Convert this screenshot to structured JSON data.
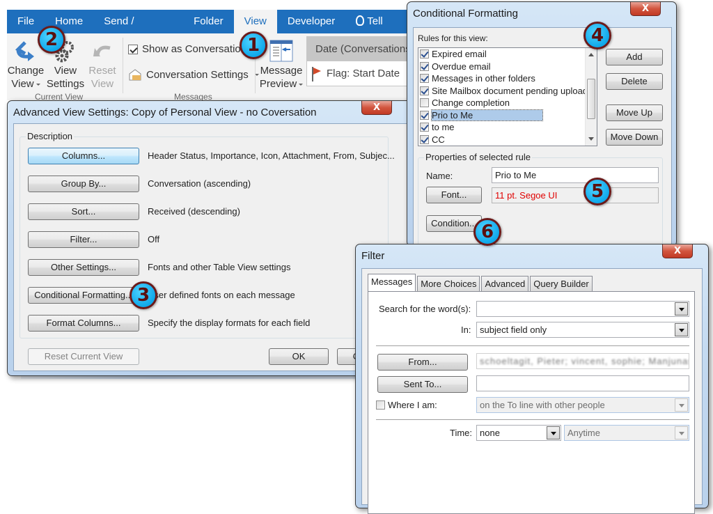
{
  "ribbon": {
    "tabs": [
      "File",
      "Home",
      "Send / Receive",
      "Folder",
      "View",
      "Developer",
      "Tell me"
    ],
    "active_tab": "View",
    "current_view": {
      "change_view": [
        "Change",
        "View"
      ],
      "view_settings": [
        "View",
        "Settings"
      ],
      "reset_view": [
        "Reset",
        "View"
      ],
      "group_label": "Current View"
    },
    "messages": {
      "show_as_conversations": "Show as Conversations",
      "show_as_conversations_checked": true,
      "conversation_settings": "Conversation Settings",
      "group_label": "Messages"
    },
    "message_preview": [
      "Message",
      "Preview"
    ],
    "arrangement": [
      "Date (Conversations)",
      "Flag: Start Date"
    ]
  },
  "advanced_view": {
    "title": "Advanced View Settings: Copy of Personal View - no Coversation",
    "close_label": "X",
    "section_label": "Description",
    "rows": [
      {
        "button": "Columns...",
        "value": "Header Status, Importance, Icon, Attachment, From, Subjec..."
      },
      {
        "button": "Group By...",
        "value": "Conversation (ascending)"
      },
      {
        "button": "Sort...",
        "value": "Received (descending)"
      },
      {
        "button": "Filter...",
        "value": "Off"
      },
      {
        "button": "Other Settings...",
        "value": "Fonts and other Table View settings"
      },
      {
        "button": "Conditional Formatting...",
        "value": "User defined fonts on each message"
      },
      {
        "button": "Format Columns...",
        "value": "Specify the display formats for each field"
      }
    ],
    "reset_button": "Reset Current View",
    "ok_button": "OK",
    "cancel_button": "Cancel"
  },
  "conditional_formatting": {
    "title": "Conditional Formatting",
    "close_label": "X",
    "rules_label": "Rules for this view:",
    "rules": [
      {
        "label": "Expired email",
        "checked": true
      },
      {
        "label": "Overdue email",
        "checked": true
      },
      {
        "label": "Messages in other folders",
        "checked": true
      },
      {
        "label": "Site Mailbox document pending upload",
        "checked": true
      },
      {
        "label": "Change completion",
        "checked": false
      },
      {
        "label": "Prio to Me",
        "checked": true,
        "selected": true
      },
      {
        "label": "to me",
        "checked": true
      },
      {
        "label": "CC",
        "checked": true
      }
    ],
    "buttons": {
      "add": "Add",
      "delete": "Delete",
      "move_up": "Move Up",
      "move_down": "Move Down"
    },
    "properties_label": "Properties of selected rule",
    "name_label": "Name:",
    "name_value": "Prio to Me",
    "font_button": "Font...",
    "font_preview": "11 pt. Segoe UI",
    "font_preview_color": "#e00000",
    "condition_button": "Condition..."
  },
  "filter": {
    "title": "Filter",
    "close_label": "X",
    "tabs": [
      "Messages",
      "More Choices",
      "Advanced",
      "Query Builder"
    ],
    "active_tab": "Messages",
    "search_label": "Search for the word(s):",
    "search_value": "",
    "in_label": "In:",
    "in_value": "subject field only",
    "from_button": "From...",
    "from_value": "schoeltagit, Pieter; vincent, sophie; Manjunas, adele",
    "sent_to_button": "Sent To...",
    "sent_to_value": "",
    "where_i_am_label": "Where I am:",
    "where_i_am_checked": false,
    "where_i_am_value": "on the To line with other people",
    "time_label": "Time:",
    "time_value": "none",
    "time_range_value": "Anytime"
  },
  "callouts": [
    "1",
    "2",
    "3",
    "4",
    "5",
    "6"
  ],
  "colors": {
    "ribbon_blue": "#1e6fbd",
    "callout_fill": "#10a8ea",
    "callout_border": "#6b1a1a",
    "selection": "#aecbea"
  }
}
